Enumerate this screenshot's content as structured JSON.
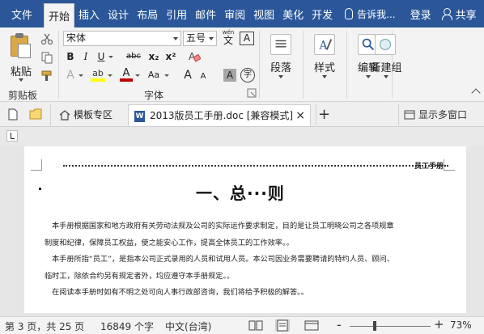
{
  "menu": {
    "file": "文件",
    "tabs": [
      "开始",
      "插入",
      "设计",
      "布局",
      "引用",
      "邮件",
      "审阅",
      "视图",
      "美化",
      "开发"
    ],
    "active_tab": "开始",
    "tell_me": "告诉我...",
    "login": "登录",
    "share": "共享"
  },
  "ribbon": {
    "clipboard": {
      "paste": "粘贴",
      "group": "剪贴板"
    },
    "font": {
      "family": "宋体",
      "size": "五号",
      "wen_top": "wén",
      "wen_char": "文",
      "boxed_a": "A",
      "bold": "B",
      "italic": "I",
      "underline": "U",
      "strike": "abc",
      "sub": "x₂",
      "sup": "x²",
      "effects": "A",
      "highlight": "ab",
      "color": "A",
      "aa_case": "Aa",
      "grow": "A",
      "shrink": "A",
      "shade": "A",
      "circle": "字",
      "group": "字体"
    },
    "paragraph": "段落",
    "styles": "样式",
    "editing": "编辑",
    "newgroup": "新建组"
  },
  "tabs": {
    "template_zone": "模板专区",
    "doc_title": "2013版员工手册.doc [兼容模式]",
    "close": "×",
    "add": "+",
    "multi_window": "显示多窗口"
  },
  "document": {
    "header_text": "员工手册",
    "title": "一、总···则",
    "paragraphs": [
      "本手册根据国家和地方政府有关劳动法规及公司的实际运作要求制定，目的是让员工明晓公司之各项规章",
      "制度和纪律，保障员工权益，使之能安心工作，提高全体员工的工作效率。。",
      "本手册所指“员工”，是指本公司正式录用的人员和试用人员。本公司因业务需要聘请的特约人员、顾问、",
      "临时工，除依合约另有规定者外，均应遵守本手册规定。。",
      "在阅读本手册时如有不明之处可向人事行政部咨询，我们将给予积极的解答。。"
    ]
  },
  "status": {
    "page": "第 3 页，共 25 页",
    "words": "16849 个字",
    "language": "中文(台湾)",
    "zoom_minus": "-",
    "zoom_plus": "+",
    "zoom": "73%"
  },
  "colors": {
    "title_bar": "#2b579a",
    "highlight_yellow": "#ffff00",
    "font_color_red": "#c00000"
  }
}
